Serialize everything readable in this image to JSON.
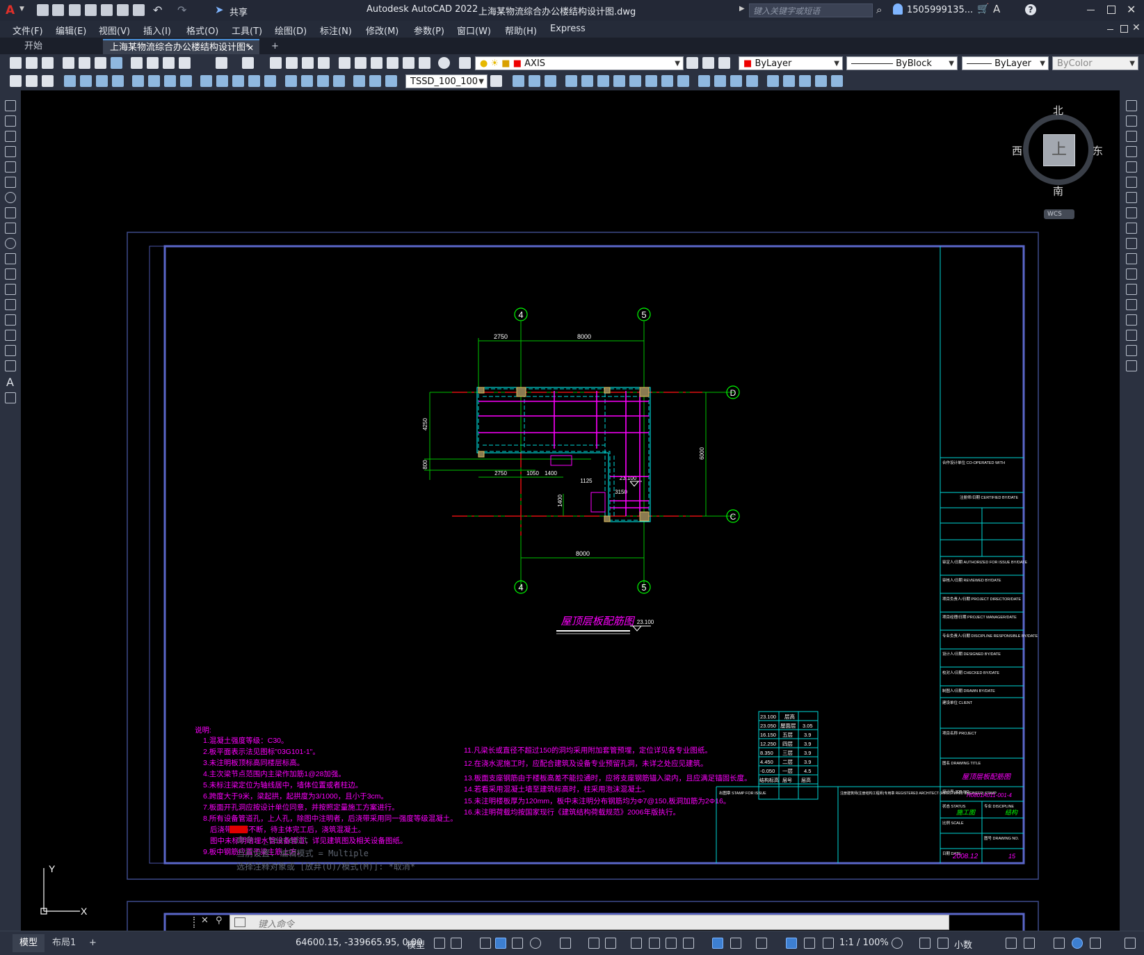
{
  "app": {
    "title": "Autodesk AutoCAD 2022",
    "filename": "上海某物流综合办公楼结构设计图.dwg",
    "search_placeholder": "键入关键字或短语",
    "user": "1505999135...",
    "share": "共享"
  },
  "menu": [
    "文件(F)",
    "编辑(E)",
    "视图(V)",
    "插入(I)",
    "格式(O)",
    "工具(T)",
    "绘图(D)",
    "标注(N)",
    "修改(M)",
    "参数(P)",
    "窗口(W)",
    "帮助(H)",
    "Express"
  ],
  "tabs": {
    "start": "开始",
    "active": "上海某物流综合办公楼结构设计图*",
    "add": "+"
  },
  "toolbar": {
    "layer": "AXIS",
    "color": "ByLayer",
    "linetype": "ByBlock",
    "lineweight": "ByLayer",
    "plotstyle": "ByColor",
    "dimstyle": "TSSD_100_100"
  },
  "viewcube": {
    "north": "北",
    "south": "南",
    "east": "东",
    "west": "西",
    "top": "上",
    "wcs": "WCS"
  },
  "ucs": {
    "y": "Y",
    "x": "X"
  },
  "drawing": {
    "axes": {
      "a4": "4",
      "a5": "5",
      "d": "D",
      "c": "C"
    },
    "dims": {
      "d2750": "2750",
      "d8000": "8000",
      "d4250": "4250",
      "d800": "800",
      "d1050": "1050",
      "d1400": "1400",
      "d1125": "1125",
      "d3150": "3150",
      "d6000": "6000",
      "d23100": "23.100"
    },
    "title": "屋顶层板配筋图",
    "elev_label": "23.100",
    "notes_head": "说明:",
    "notes_left": [
      "1.混凝土强度等级：C30。",
      "2.板平面表示法见图标\"03G101-1\"。",
      "3.未注明板顶标高同楼层标高。",
      "4.主次梁节点范围内主梁作加筋1@28加强。",
      "5.未标注梁定位为轴线居中，墙体位置或者柱边。",
      "6.跨度大于9米，梁起拱，起拱度为3/1000，且小于3cm。",
      "7.板面开孔洞应按设计单位同意，并按照定量施工方案进行。",
      "8.所有设备管道孔，上人孔，除图中注明者，后浇带采用同一强度等级混凝土。",
      "后浇带 钢筋不断，待主体完工后，浇筑混凝土。",
      "图中未标明暗埋水管设备管道，详见建筑图及相关设备图纸。",
      "9.板中钢筋应置于梁主筋上方。"
    ],
    "notes_right": [
      "11.凡梁长或直径不超过150的洞均采用附加套管预埋，定位详见各专业图纸。",
      "12.在浇水泥施工时，应配合建筑及设备专业预留孔洞，未详之处应见建筑。",
      "13.板面支座钢筋由于楼板高差不能拉通时，应将支座钢筋锚入梁内，且应满足锚固长度。",
      "14.若看采用混凝土墙至建筑标高时，柱采用泡沫混凝土。",
      "15.未注明楼板厚为120mm，板中未注明分布钢筋均为Φ7@150,板洞加筋为2Φ16。",
      "16.未注明荷载均按国家现行《建筑结构荷载规范》2006年版执行。"
    ],
    "level_table": {
      "heads": [
        "23.100",
        "层高"
      ],
      "rows": [
        [
          "23.050",
          "屋面层",
          "3.05"
        ],
        [
          "16.150",
          "五层",
          "3.9"
        ],
        [
          "12.250",
          "四层",
          "3.9"
        ],
        [
          "8.350",
          "三层",
          "3.9"
        ],
        [
          "4.450",
          "二层",
          "3.9"
        ],
        [
          "-0.050",
          "一层",
          "4.5"
        ],
        [
          "结构标高",
          "层号",
          "层高"
        ]
      ]
    },
    "title_block": {
      "cooperated": "合作设计单位 CO-OPERATED WITH",
      "certified": "注册师/日期 CERTIFIED BY/DATE",
      "rows": [
        "审定人/日期 AUTHORIZED FOR ISSUE BY/DATE",
        "审核人/日期 REVIEWED BY/DATE",
        "项目负责人/日期 PROJECT DIRECTOR/DATE",
        "项目经理/日期 PROJECT MANAGER/DATE",
        "专业负责人/日期 DISCIPLINE RESPONSIBLE BY/DATE",
        "设计人/日期 DESIGNED BY/DATE",
        "校对人/日期 CHECKED BY/DATE",
        "制图人/日期 DRAWN BY/DATE"
      ],
      "client": "建设单位 CLIENT",
      "project": "项目名称 PROJECT",
      "drawing_title_label": "图名 DRAWING TITLE",
      "drawing_title": "屋顶层板配筋图",
      "job_no_label": "设计号 JOB NO.",
      "job_no": "H0801A011-001-4",
      "status_label": "状态 STATUS",
      "status": "施工图",
      "discipline_label": "专业 DISCIPLINE",
      "discipline": "结构",
      "scale_label": "比例 SCALE",
      "date_label": "日期 DATE",
      "date": "2008.12",
      "drawing_no_label": "图号 DRAWING NO.",
      "drawing_no": "15",
      "stamp_issue": "出图章 STAMP FOR ISSUE",
      "stamp_reg": "注册建筑师(注册结构工程师)专用章 REGISTERED ARCHITECT (REGISTERED ENGINEER) STAMP"
    }
  },
  "command": {
    "history": [
      "命令: _textedit",
      "当前设置: 编辑模式 = Multiple",
      "选择注释对象或 [放弃(U)/模式(M)]: *取消*"
    ],
    "placeholder": "键入命令"
  },
  "status": {
    "coords": "64600.15, -339665.95, 0.00",
    "model": "模型",
    "scale": "1:1 / 100%",
    "units": "小数",
    "layout_tabs": [
      "模型",
      "布局1",
      "+"
    ]
  }
}
